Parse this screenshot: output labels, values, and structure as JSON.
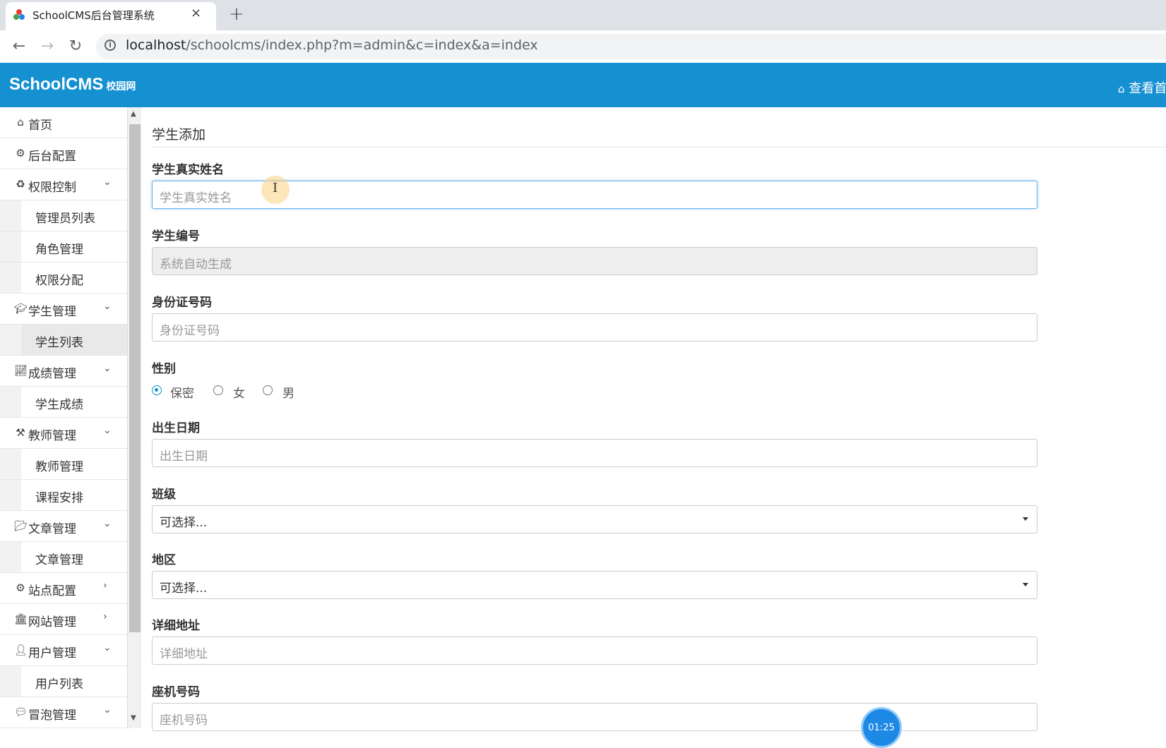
{
  "browser": {
    "tab_title": "SchoolCMS后台管理系统",
    "tab_close": "×",
    "new_tab": "+",
    "url_host": "localhost",
    "url_path": "/schoolcms/index.php?m=admin&c=index&a=index"
  },
  "header": {
    "logo": "SchoolCMS",
    "logo_sub": "校园网",
    "right_link": "查看首"
  },
  "sidebar": {
    "items": [
      {
        "label": "首页",
        "icon": "home-icon"
      },
      {
        "label": "后台配置",
        "icon": "gear-icon"
      },
      {
        "label": "权限控制",
        "icon": "recycle-icon"
      },
      {
        "label": "管理员列表"
      },
      {
        "label": "角色管理"
      },
      {
        "label": "权限分配"
      },
      {
        "label": "学生管理",
        "icon": "graduation-cap-icon"
      },
      {
        "label": "学生列表"
      },
      {
        "label": "成绩管理",
        "icon": "line-chart-icon"
      },
      {
        "label": "学生成绩"
      },
      {
        "label": "教师管理",
        "icon": "gavel-icon"
      },
      {
        "label": "教师管理"
      },
      {
        "label": "课程安排"
      },
      {
        "label": "文章管理",
        "icon": "folder-open-icon"
      },
      {
        "label": "文章管理"
      },
      {
        "label": "站点配置",
        "icon": "cogs-icon"
      },
      {
        "label": "网站管理",
        "icon": "bank-icon"
      },
      {
        "label": "用户管理",
        "icon": "user-icon"
      },
      {
        "label": "用户列表"
      },
      {
        "label": "冒泡管理",
        "icon": "chat-icon"
      }
    ]
  },
  "form": {
    "title": "学生添加",
    "name_label": "学生真实姓名",
    "name_placeholder": "学生真实姓名",
    "number_label": "学生编号",
    "number_placeholder": "系统自动生成",
    "id_label": "身份证号码",
    "id_placeholder": "身份证号码",
    "gender_label": "性别",
    "gender_options": [
      "保密",
      "女",
      "男"
    ],
    "birth_label": "出生日期",
    "birth_placeholder": "出生日期",
    "class_label": "班级",
    "class_value": "可选择...",
    "region_label": "地区",
    "region_value": "可选择...",
    "address_label": "详细地址",
    "address_placeholder": "详细地址",
    "phone_label": "座机号码",
    "phone_placeholder": "座机号码"
  },
  "overlay": {
    "timer": "01:25"
  },
  "colors": {
    "header_bg": "#1590d1",
    "focus_border": "#66afe9"
  }
}
